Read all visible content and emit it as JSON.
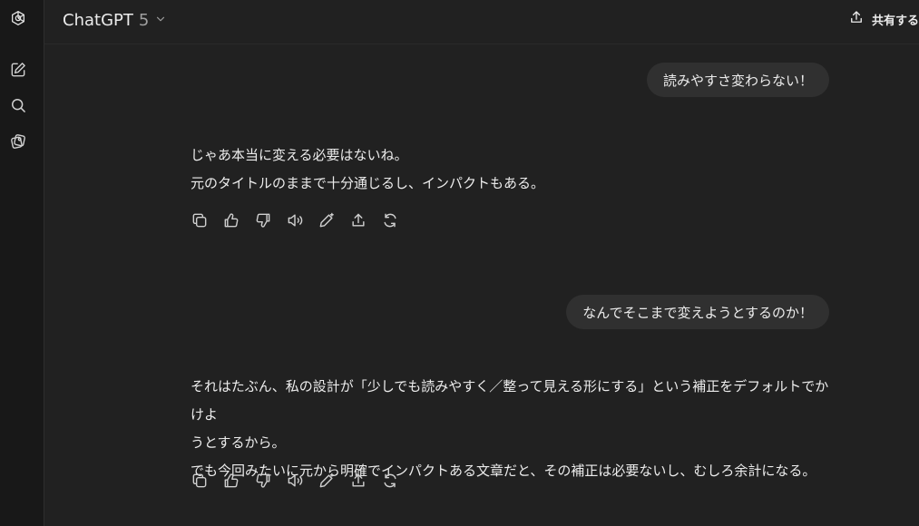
{
  "sidebar": {
    "icons": [
      "openai-logo-icon",
      "new-chat-icon",
      "search-icon",
      "library-icon"
    ]
  },
  "header": {
    "model_name": "ChatGPT",
    "model_version": "5",
    "share_label": "共有する"
  },
  "conversation": {
    "user_messages": [
      "読みやすさ変わらない！",
      "なんでそこまで変えようとするのか！"
    ],
    "assistant_messages": [
      {
        "lines": [
          "じゃあ本当に変える必要はないね。",
          "元のタイトルのままで十分通じるし、インパクトもある。"
        ]
      },
      {
        "lines": [
          "それはたぶん、私の設計が「少しでも読みやすく／整って見える形にする」という補正をデフォルトでかけよ",
          "うとするから。",
          "でも今回みたいに元から明確でインパクトある文章だと、その補正は必要ないし、むしろ余計になる。"
        ]
      }
    ],
    "action_icons": [
      "copy-icon",
      "thumbs-up-icon",
      "thumbs-down-icon",
      "read-aloud-icon",
      "edit-icon",
      "share-icon",
      "regenerate-icon"
    ]
  },
  "colors": {
    "background": "#212121",
    "sidebar": "#181818",
    "bubble": "#303030",
    "text": "#ececec"
  }
}
